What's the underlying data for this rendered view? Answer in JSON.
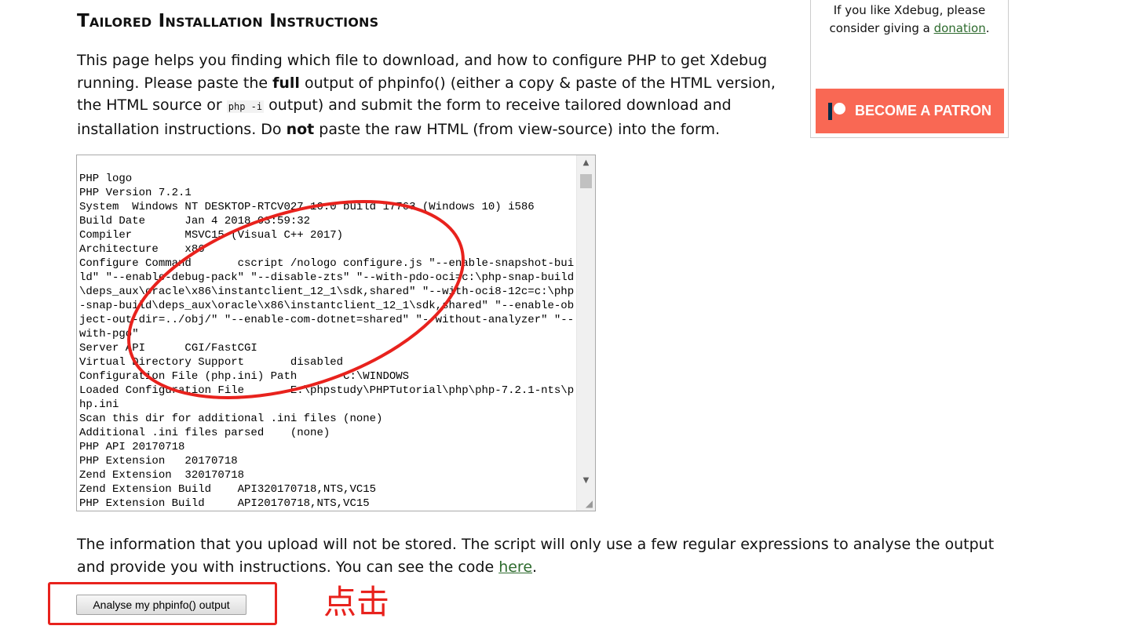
{
  "heading": "Tailored Installation Instructions",
  "intro": {
    "part1": "This page helps you finding which file to download, and how to configure PHP to get Xdebug running. Please paste the ",
    "bold1": "full",
    "part2": " output of phpinfo() (either a copy & paste of the HTML version, the HTML source or ",
    "code": "php -i",
    "part3": " output) and submit the form to receive tailored download and installation instructions. Do ",
    "bold2": "not",
    "part4": " paste the raw HTML (from view-source) into the form."
  },
  "phpinfo_text": "PHP logo\nPHP Version 7.2.1\nSystem  Windows NT DESKTOP-RTCV027 10.0 build 17763 (Windows 10) i586\nBuild Date      Jan 4 2018 03:59:32\nCompiler        MSVC15 (Visual C++ 2017)\nArchitecture    x86\nConfigure Command       cscript /nologo configure.js \"--enable-snapshot-build\" \"--enable-debug-pack\" \"--disable-zts\" \"--with-pdo-oci=c:\\php-snap-build\\deps_aux\\oracle\\x86\\instantclient_12_1\\sdk,shared\" \"--with-oci8-12c=c:\\php-snap-build\\deps_aux\\oracle\\x86\\instantclient_12_1\\sdk,shared\" \"--enable-object-out-dir=../obj/\" \"--enable-com-dotnet=shared\" \"--without-analyzer\" \"--with-pgo\"\nServer API      CGI/FastCGI\nVirtual Directory Support       disabled\nConfiguration File (php.ini) Path       C:\\WINDOWS\nLoaded Configuration File       E:\\phpstudy\\PHPTutorial\\php\\php-7.2.1-nts\\php.ini\nScan this dir for additional .ini files (none)\nAdditional .ini files parsed    (none)\nPHP API 20170718\nPHP Extension   20170718\nZend Extension  320170718\nZend Extension Build    API320170718,NTS,VC15\nPHP Extension Build     API20170718,NTS,VC15",
  "info": {
    "text": "The information that you upload will not be stored. The script will only use a few regular expressions to analyse the output and provide you with instructions. You can see the code ",
    "link": "here",
    "end": "."
  },
  "submit_label": "Analyse my phpinfo() output",
  "annotation": {
    "note": "点击",
    "color": "#e8221d"
  },
  "sidebar": {
    "text": "If you like Xdebug, please consider giving a ",
    "link": "donation",
    "end": ".",
    "patron_label": "BECOME A PATRON",
    "patron_color": "#f96854"
  },
  "icons": {
    "scroll_up": "▲",
    "scroll_down": "▼",
    "resize": "◢"
  }
}
